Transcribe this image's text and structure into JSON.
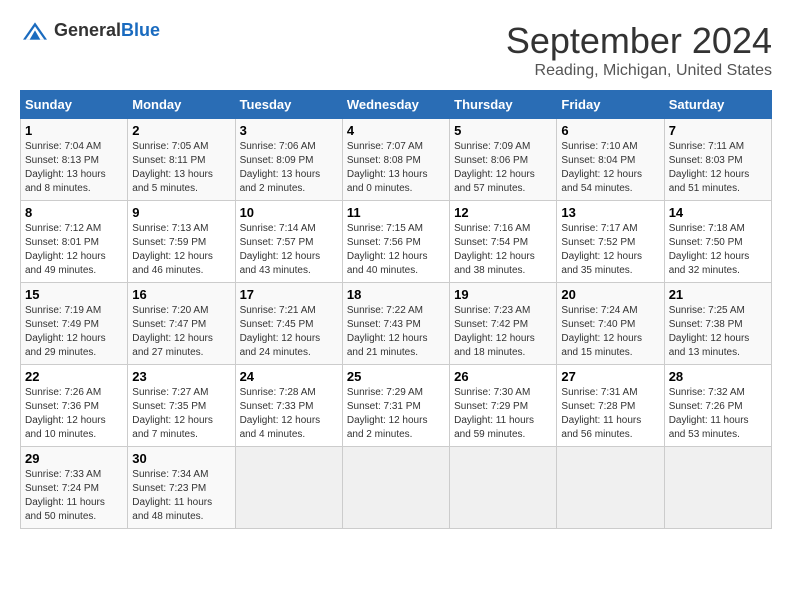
{
  "header": {
    "logo_general": "General",
    "logo_blue": "Blue",
    "month_title": "September 2024",
    "location": "Reading, Michigan, United States"
  },
  "calendar": {
    "days_of_week": [
      "Sunday",
      "Monday",
      "Tuesday",
      "Wednesday",
      "Thursday",
      "Friday",
      "Saturday"
    ],
    "weeks": [
      [
        {
          "day": "1",
          "sunrise": "Sunrise: 7:04 AM",
          "sunset": "Sunset: 8:13 PM",
          "daylight": "Daylight: 13 hours and 8 minutes."
        },
        {
          "day": "2",
          "sunrise": "Sunrise: 7:05 AM",
          "sunset": "Sunset: 8:11 PM",
          "daylight": "Daylight: 13 hours and 5 minutes."
        },
        {
          "day": "3",
          "sunrise": "Sunrise: 7:06 AM",
          "sunset": "Sunset: 8:09 PM",
          "daylight": "Daylight: 13 hours and 2 minutes."
        },
        {
          "day": "4",
          "sunrise": "Sunrise: 7:07 AM",
          "sunset": "Sunset: 8:08 PM",
          "daylight": "Daylight: 13 hours and 0 minutes."
        },
        {
          "day": "5",
          "sunrise": "Sunrise: 7:09 AM",
          "sunset": "Sunset: 8:06 PM",
          "daylight": "Daylight: 12 hours and 57 minutes."
        },
        {
          "day": "6",
          "sunrise": "Sunrise: 7:10 AM",
          "sunset": "Sunset: 8:04 PM",
          "daylight": "Daylight: 12 hours and 54 minutes."
        },
        {
          "day": "7",
          "sunrise": "Sunrise: 7:11 AM",
          "sunset": "Sunset: 8:03 PM",
          "daylight": "Daylight: 12 hours and 51 minutes."
        }
      ],
      [
        {
          "day": "8",
          "sunrise": "Sunrise: 7:12 AM",
          "sunset": "Sunset: 8:01 PM",
          "daylight": "Daylight: 12 hours and 49 minutes."
        },
        {
          "day": "9",
          "sunrise": "Sunrise: 7:13 AM",
          "sunset": "Sunset: 7:59 PM",
          "daylight": "Daylight: 12 hours and 46 minutes."
        },
        {
          "day": "10",
          "sunrise": "Sunrise: 7:14 AM",
          "sunset": "Sunset: 7:57 PM",
          "daylight": "Daylight: 12 hours and 43 minutes."
        },
        {
          "day": "11",
          "sunrise": "Sunrise: 7:15 AM",
          "sunset": "Sunset: 7:56 PM",
          "daylight": "Daylight: 12 hours and 40 minutes."
        },
        {
          "day": "12",
          "sunrise": "Sunrise: 7:16 AM",
          "sunset": "Sunset: 7:54 PM",
          "daylight": "Daylight: 12 hours and 38 minutes."
        },
        {
          "day": "13",
          "sunrise": "Sunrise: 7:17 AM",
          "sunset": "Sunset: 7:52 PM",
          "daylight": "Daylight: 12 hours and 35 minutes."
        },
        {
          "day": "14",
          "sunrise": "Sunrise: 7:18 AM",
          "sunset": "Sunset: 7:50 PM",
          "daylight": "Daylight: 12 hours and 32 minutes."
        }
      ],
      [
        {
          "day": "15",
          "sunrise": "Sunrise: 7:19 AM",
          "sunset": "Sunset: 7:49 PM",
          "daylight": "Daylight: 12 hours and 29 minutes."
        },
        {
          "day": "16",
          "sunrise": "Sunrise: 7:20 AM",
          "sunset": "Sunset: 7:47 PM",
          "daylight": "Daylight: 12 hours and 27 minutes."
        },
        {
          "day": "17",
          "sunrise": "Sunrise: 7:21 AM",
          "sunset": "Sunset: 7:45 PM",
          "daylight": "Daylight: 12 hours and 24 minutes."
        },
        {
          "day": "18",
          "sunrise": "Sunrise: 7:22 AM",
          "sunset": "Sunset: 7:43 PM",
          "daylight": "Daylight: 12 hours and 21 minutes."
        },
        {
          "day": "19",
          "sunrise": "Sunrise: 7:23 AM",
          "sunset": "Sunset: 7:42 PM",
          "daylight": "Daylight: 12 hours and 18 minutes."
        },
        {
          "day": "20",
          "sunrise": "Sunrise: 7:24 AM",
          "sunset": "Sunset: 7:40 PM",
          "daylight": "Daylight: 12 hours and 15 minutes."
        },
        {
          "day": "21",
          "sunrise": "Sunrise: 7:25 AM",
          "sunset": "Sunset: 7:38 PM",
          "daylight": "Daylight: 12 hours and 13 minutes."
        }
      ],
      [
        {
          "day": "22",
          "sunrise": "Sunrise: 7:26 AM",
          "sunset": "Sunset: 7:36 PM",
          "daylight": "Daylight: 12 hours and 10 minutes."
        },
        {
          "day": "23",
          "sunrise": "Sunrise: 7:27 AM",
          "sunset": "Sunset: 7:35 PM",
          "daylight": "Daylight: 12 hours and 7 minutes."
        },
        {
          "day": "24",
          "sunrise": "Sunrise: 7:28 AM",
          "sunset": "Sunset: 7:33 PM",
          "daylight": "Daylight: 12 hours and 4 minutes."
        },
        {
          "day": "25",
          "sunrise": "Sunrise: 7:29 AM",
          "sunset": "Sunset: 7:31 PM",
          "daylight": "Daylight: 12 hours and 2 minutes."
        },
        {
          "day": "26",
          "sunrise": "Sunrise: 7:30 AM",
          "sunset": "Sunset: 7:29 PM",
          "daylight": "Daylight: 11 hours and 59 minutes."
        },
        {
          "day": "27",
          "sunrise": "Sunrise: 7:31 AM",
          "sunset": "Sunset: 7:28 PM",
          "daylight": "Daylight: 11 hours and 56 minutes."
        },
        {
          "day": "28",
          "sunrise": "Sunrise: 7:32 AM",
          "sunset": "Sunset: 7:26 PM",
          "daylight": "Daylight: 11 hours and 53 minutes."
        }
      ],
      [
        {
          "day": "29",
          "sunrise": "Sunrise: 7:33 AM",
          "sunset": "Sunset: 7:24 PM",
          "daylight": "Daylight: 11 hours and 50 minutes."
        },
        {
          "day": "30",
          "sunrise": "Sunrise: 7:34 AM",
          "sunset": "Sunset: 7:23 PM",
          "daylight": "Daylight: 11 hours and 48 minutes."
        },
        {
          "day": "",
          "sunrise": "",
          "sunset": "",
          "daylight": ""
        },
        {
          "day": "",
          "sunrise": "",
          "sunset": "",
          "daylight": ""
        },
        {
          "day": "",
          "sunrise": "",
          "sunset": "",
          "daylight": ""
        },
        {
          "day": "",
          "sunrise": "",
          "sunset": "",
          "daylight": ""
        },
        {
          "day": "",
          "sunrise": "",
          "sunset": "",
          "daylight": ""
        }
      ]
    ]
  }
}
